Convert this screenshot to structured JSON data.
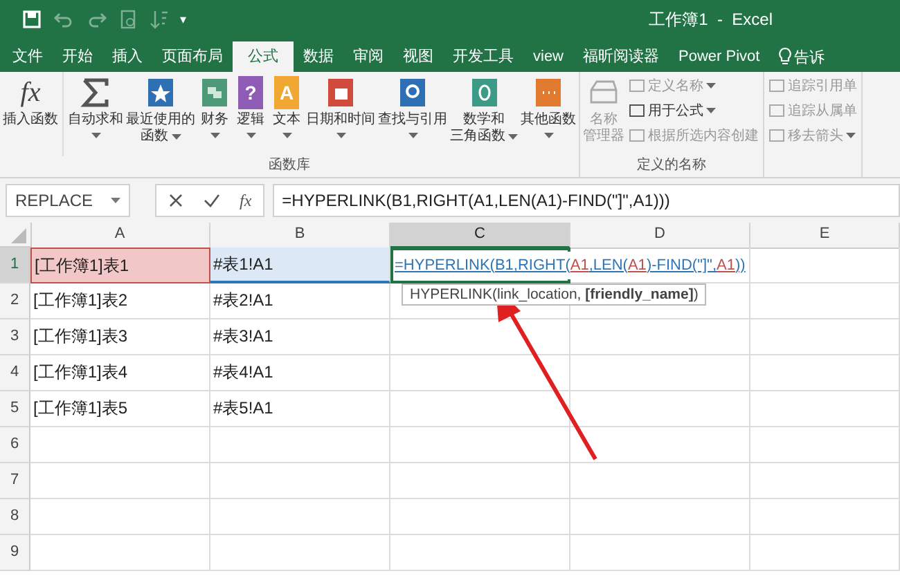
{
  "window": {
    "title": "工作簿1  -  Excel"
  },
  "quick_access": {
    "customize": "▾"
  },
  "tabs": [
    {
      "label": "文件",
      "selected": false
    },
    {
      "label": "开始",
      "selected": false
    },
    {
      "label": "插入",
      "selected": false
    },
    {
      "label": "页面布局",
      "selected": false
    },
    {
      "label": "公式",
      "selected": true
    },
    {
      "label": "数据",
      "selected": false
    },
    {
      "label": "审阅",
      "selected": false
    },
    {
      "label": "视图",
      "selected": false
    },
    {
      "label": "开发工具",
      "selected": false
    },
    {
      "label": "view",
      "selected": false
    },
    {
      "label": "福昕阅读器",
      "selected": false
    },
    {
      "label": "Power Pivot",
      "selected": false
    }
  ],
  "tell_me": {
    "label": "告诉"
  },
  "ribbon": {
    "groups": [
      {
        "label": "函数库",
        "buttons": [
          {
            "lines": [
              "插入函数"
            ],
            "dropdown": false,
            "icon_text": "fx"
          },
          {
            "lines": [
              "自动求和"
            ],
            "dropdown": true
          },
          {
            "lines": [
              "最近使用的",
              "函数"
            ],
            "dropdown": true
          },
          {
            "lines": [
              "财务"
            ],
            "dropdown": true
          },
          {
            "lines": [
              "逻辑"
            ],
            "dropdown": true,
            "icon_text": "?"
          },
          {
            "lines": [
              "文本"
            ],
            "dropdown": true,
            "icon_text": "A"
          },
          {
            "lines": [
              "日期和时间"
            ],
            "dropdown": true
          },
          {
            "lines": [
              "查找与引用"
            ],
            "dropdown": true
          },
          {
            "lines": [
              "数学和",
              "三角函数"
            ],
            "dropdown": true
          },
          {
            "lines": [
              "其他函数"
            ],
            "dropdown": true
          }
        ]
      },
      {
        "label": "定义的名称",
        "large": {
          "lines": [
            "名称",
            "管理器"
          ],
          "disabled": true
        },
        "small": [
          {
            "label": "定义名称",
            "dropdown": true,
            "disabled": true
          },
          {
            "label": "用于公式",
            "dropdown": true,
            "disabled": false
          },
          {
            "label": "根据所选内容创建",
            "dropdown": false,
            "disabled": true
          }
        ]
      },
      {
        "small": [
          {
            "label": "追踪引用单",
            "dropdown": false,
            "disabled": true
          },
          {
            "label": "追踪从属单",
            "dropdown": false,
            "disabled": true
          },
          {
            "label": "移去箭头",
            "dropdown": true,
            "disabled": true
          }
        ]
      }
    ]
  },
  "name_box": {
    "value": "REPLACE"
  },
  "formula_bar": {
    "function_button": "fx",
    "value": "=HYPERLINK(B1,RIGHT(A1,LEN(A1)-FIND(\"]\",A1)))"
  },
  "sheet": {
    "columns": [
      {
        "label": "A",
        "selected": false
      },
      {
        "label": "B",
        "selected": false
      },
      {
        "label": "C",
        "selected": true
      },
      {
        "label": "D",
        "selected": false
      },
      {
        "label": "E",
        "selected": false
      }
    ],
    "rows": [
      {
        "number": "1",
        "cells": [
          "[工作簿1]表1",
          "#表1!A1"
        ]
      },
      {
        "number": "2",
        "cells": [
          "[工作簿1]表2",
          "#表2!A1"
        ]
      },
      {
        "number": "3",
        "cells": [
          "[工作簿1]表3",
          "#表3!A1"
        ]
      },
      {
        "number": "4",
        "cells": [
          "[工作簿1]表4",
          "#表4!A1"
        ]
      },
      {
        "number": "5",
        "cells": [
          "[工作簿1]表5",
          "#表5!A1"
        ]
      },
      {
        "number": "6",
        "cells": []
      },
      {
        "number": "7",
        "cells": []
      },
      {
        "number": "8",
        "cells": []
      },
      {
        "number": "9",
        "cells": []
      }
    ],
    "editing_formula": [
      {
        "text": "=HYPERLINK(",
        "color": "#2e75b6"
      },
      {
        "text": "B1",
        "color": "#2e75b6"
      },
      {
        "text": ",RIGHT(",
        "color": "#2e75b6"
      },
      {
        "text": "A1",
        "color": "#c0504d"
      },
      {
        "text": ",LEN(",
        "color": "#2e75b6"
      },
      {
        "text": "A1",
        "color": "#c0504d"
      },
      {
        "text": ")-FIND(\"]\",",
        "color": "#2e75b6"
      },
      {
        "text": "A1",
        "color": "#c0504d"
      },
      {
        "text": "))",
        "color": "#2e75b6"
      }
    ],
    "tooltip": "HYPERLINK(link_location, **[friendly_name]**)"
  }
}
